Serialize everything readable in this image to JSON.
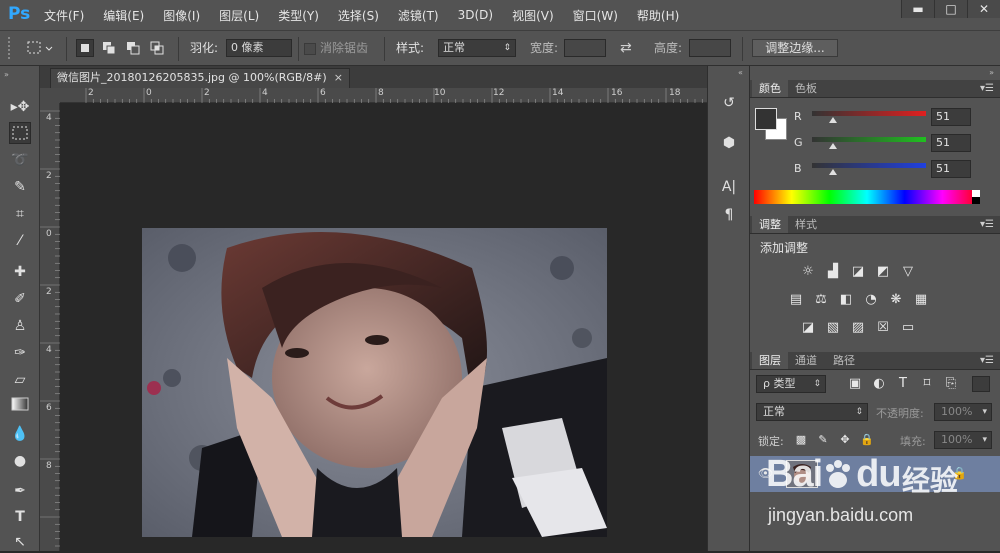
{
  "app": {
    "logo": "Ps",
    "accent": "#31a8ff"
  },
  "menu": [
    "文件(F)",
    "编辑(E)",
    "图像(I)",
    "图层(L)",
    "类型(Y)",
    "选择(S)",
    "滤镜(T)",
    "3D(D)",
    "视图(V)",
    "窗口(W)",
    "帮助(H)"
  ],
  "window_controls": {
    "minimize": "▬",
    "maximize": "□",
    "close": "✕"
  },
  "options": {
    "feather_label": "羽化:",
    "feather_value": "0 像素",
    "antialias_label": "消除锯齿",
    "style_label": "样式:",
    "style_value": "正常",
    "width_label": "宽度:",
    "height_label": "高度:",
    "refine_edge": "调整边缘..."
  },
  "document": {
    "tab_title": "微信图片_20180126205835.jpg @ 100%(RGB/8#)",
    "tab_close": "×"
  },
  "rulers": {
    "top": [
      "2",
      "0",
      "2",
      "4",
      "6",
      "8",
      "10",
      "12",
      "14",
      "16",
      "18"
    ],
    "left": [
      "4",
      "2",
      "0",
      "2",
      "4",
      "6",
      "8"
    ]
  },
  "color_panel": {
    "tabs": [
      "颜色",
      "色板"
    ],
    "rows": [
      {
        "label": "R",
        "value": "51"
      },
      {
        "label": "G",
        "value": "51"
      },
      {
        "label": "B",
        "value": "51"
      }
    ],
    "foreground": "#333333",
    "background": "#ffffff"
  },
  "adjust_panel": {
    "tabs": [
      "调整",
      "样式"
    ],
    "title": "添加调整"
  },
  "layers_panel": {
    "tabs": [
      "图层",
      "通道",
      "路径"
    ],
    "filter_label": "ρ 类型",
    "blend_mode": "正常",
    "opacity_label": "不透明度:",
    "opacity_value": "100%",
    "lock_label": "锁定:",
    "fill_label": "填充:",
    "fill_value": "100%"
  },
  "watermark": {
    "brand": "Bai",
    "brand2": "du",
    "cn": "经验",
    "url": "jingyan.baidu.com"
  }
}
